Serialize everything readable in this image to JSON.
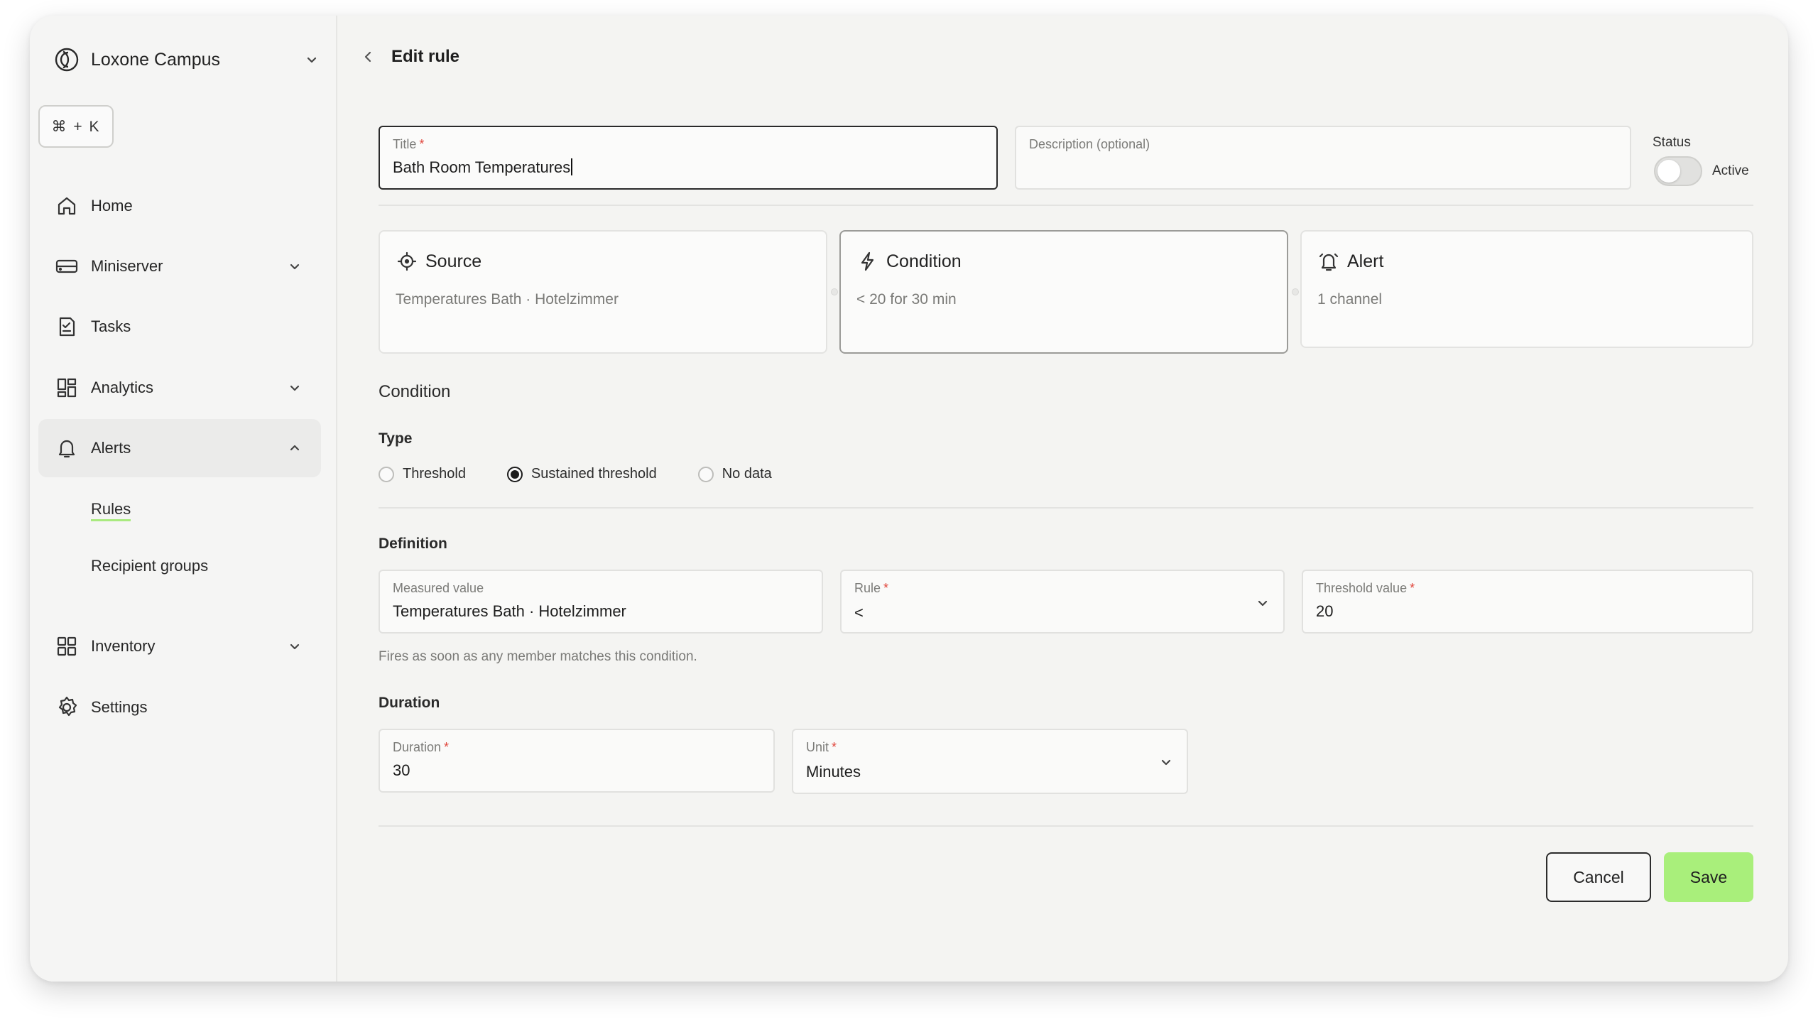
{
  "sidebar": {
    "org_name": "Loxone Campus",
    "shortcut": "⌘ + K",
    "items": [
      {
        "label": "Home",
        "icon": "home-icon"
      },
      {
        "label": "Miniserver",
        "icon": "miniserver-icon"
      },
      {
        "label": "Tasks",
        "icon": "tasks-icon"
      },
      {
        "label": "Analytics",
        "icon": "analytics-icon"
      },
      {
        "label": "Alerts",
        "icon": "bell-icon"
      },
      {
        "label": "Inventory",
        "icon": "inventory-icon"
      },
      {
        "label": "Settings",
        "icon": "gear-icon"
      }
    ],
    "alerts_sub": [
      {
        "label": "Rules"
      },
      {
        "label": "Recipient groups"
      }
    ]
  },
  "header": {
    "title": "Edit rule"
  },
  "form": {
    "title_label": "Title",
    "required_mark": "*",
    "title_value": "Bath Room Temperatures",
    "description_label": "Description (optional)",
    "status_label": "Status",
    "status_text": "Active",
    "status_on": false
  },
  "steps": [
    {
      "title": "Source",
      "subtitle": "Temperatures Bath · Hotelzimmer"
    },
    {
      "title": "Condition",
      "subtitle": "< 20 for 30 min"
    },
    {
      "title": "Alert",
      "subtitle": "1 channel"
    }
  ],
  "condition": {
    "section_title": "Condition",
    "type_label": "Type",
    "types": [
      "Threshold",
      "Sustained threshold",
      "No data"
    ],
    "selected_type": "Sustained threshold",
    "definition_label": "Definition",
    "measured_label": "Measured value",
    "measured_value": "Temperatures Bath · Hotelzimmer",
    "rule_label": "Rule",
    "rule_value": "<",
    "threshold_label": "Threshold value",
    "threshold_value": "20",
    "hint": "Fires as soon as any member matches this condition.",
    "duration_section": "Duration",
    "duration_label": "Duration",
    "duration_value": "30",
    "unit_label": "Unit",
    "unit_value": "Minutes"
  },
  "actions": {
    "cancel": "Cancel",
    "save": "Save"
  },
  "colors": {
    "accent_save": "#a9ef7b",
    "required": "#e0443a",
    "active_underline": "#a9ea7f"
  }
}
